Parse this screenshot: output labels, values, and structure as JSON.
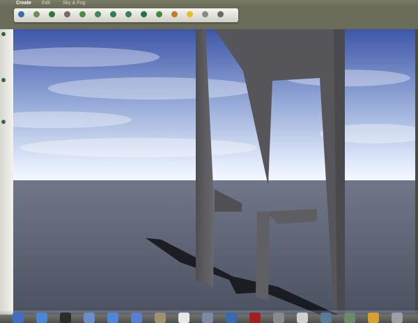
{
  "menubar": {
    "items": [
      {
        "label": "Create",
        "state": "active"
      },
      {
        "label": "Edit",
        "state": "dimmed"
      },
      {
        "label": "Sky & Fog",
        "state": "dimmed"
      }
    ]
  },
  "toolbar": {
    "tools": [
      {
        "icon": "terrain-tile-icon",
        "color": "#3a6fa8"
      },
      {
        "icon": "plane-tile-icon",
        "color": "#6f8f5a"
      },
      {
        "icon": "tree-icon",
        "color": "#2f7a35"
      },
      {
        "icon": "rock-icon",
        "color": "#7a6a5a"
      },
      {
        "icon": "plant-icon",
        "color": "#4a8f40"
      },
      {
        "icon": "sphere-icon",
        "color": "#3c8a5a"
      },
      {
        "icon": "torus-icon",
        "color": "#2e7f4f"
      },
      {
        "icon": "cube-icon",
        "color": "#3a7f5a"
      },
      {
        "icon": "cylinder-icon",
        "color": "#2f6f4a"
      },
      {
        "icon": "cone-icon",
        "color": "#3f8a3f"
      },
      {
        "icon": "figure-icon",
        "color": "#c07a2a"
      },
      {
        "icon": "light-icon",
        "color": "#e5c21a"
      },
      {
        "icon": "camera-icon",
        "color": "#888888"
      },
      {
        "icon": "navigate-icon",
        "color": "#6a6a6a"
      }
    ]
  },
  "scene": {
    "sky_top": "#3f56a8",
    "sky_horizon": "#f4f8ff",
    "ground_near": "#4b5362",
    "ground_far": "#6f7789",
    "structure_color": "#56565a"
  },
  "dock": {
    "icons": [
      {
        "icon": "finder-icon",
        "color": "#3d6fc6"
      },
      {
        "icon": "app-store-icon",
        "color": "#4a86d6"
      },
      {
        "icon": "dashboard-icon",
        "color": "#2b2b2b"
      },
      {
        "icon": "mail-icon",
        "color": "#6a8ec8"
      },
      {
        "icon": "safari-icon",
        "color": "#4e86d8"
      },
      {
        "icon": "itunes-icon",
        "color": "#5a7ed0"
      },
      {
        "icon": "preview-icon",
        "color": "#a09070"
      },
      {
        "icon": "calendar-icon",
        "color": "#e8e8e8"
      },
      {
        "icon": "photos-icon",
        "color": "#7a8aa0"
      },
      {
        "icon": "music-icon",
        "color": "#3a6ab0"
      },
      {
        "icon": "photo-booth-icon",
        "color": "#a02020"
      },
      {
        "icon": "system-preferences-icon",
        "color": "#8a8a8a"
      },
      {
        "icon": "activity-monitor-icon",
        "color": "#d0d0d0"
      },
      {
        "icon": "terrain-app-icon",
        "color": "#5a7a9a"
      },
      {
        "icon": "terrain-app-icon",
        "color": "#6a8a6a"
      },
      {
        "icon": "folder-icon",
        "color": "#d8a030"
      },
      {
        "icon": "trash-icon",
        "color": "#9aa0a8"
      }
    ]
  }
}
